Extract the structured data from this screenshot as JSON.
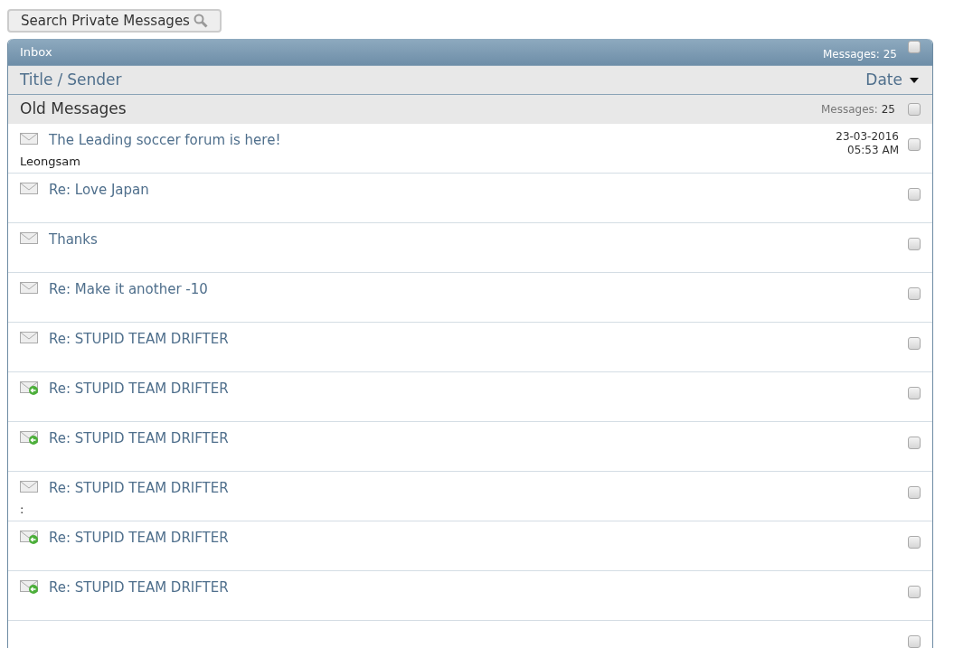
{
  "search_button": {
    "label": "Search Private Messages"
  },
  "inbox": {
    "title": "Inbox",
    "count_label": "Messages: 25",
    "checked": false
  },
  "columns": {
    "title": "Title",
    "separator": "/",
    "sender": "Sender",
    "date": "Date"
  },
  "group": {
    "title": "Old Messages",
    "count_label": "Messages:",
    "count": "25",
    "checked": false
  },
  "messages": [
    {
      "kind": "read",
      "title": "The Leading soccer forum is here!",
      "sender": "Leongsam",
      "date": "23-03-2016",
      "time": "05:53 AM",
      "checked": false
    },
    {
      "kind": "read",
      "title": "Re: Love Japan",
      "checked": false
    },
    {
      "kind": "read",
      "title": "Thanks",
      "checked": false
    },
    {
      "kind": "read",
      "title": "Re: Make it another -10",
      "checked": false
    },
    {
      "kind": "read",
      "title": "Re: STUPID TEAM DRIFTER",
      "checked": false
    },
    {
      "kind": "replied",
      "title": "Re: STUPID TEAM DRIFTER",
      "checked": false
    },
    {
      "kind": "replied",
      "title": "Re: STUPID TEAM DRIFTER",
      "checked": false
    },
    {
      "kind": "read",
      "title": "Re: STUPID TEAM DRIFTER",
      "sender": ":",
      "checked": false
    },
    {
      "kind": "replied",
      "title": "Re: STUPID TEAM DRIFTER",
      "checked": false
    },
    {
      "kind": "replied",
      "title": "Re: STUPID TEAM DRIFTER",
      "checked": false
    },
    {
      "kind": "hidden",
      "checked": false
    }
  ]
}
